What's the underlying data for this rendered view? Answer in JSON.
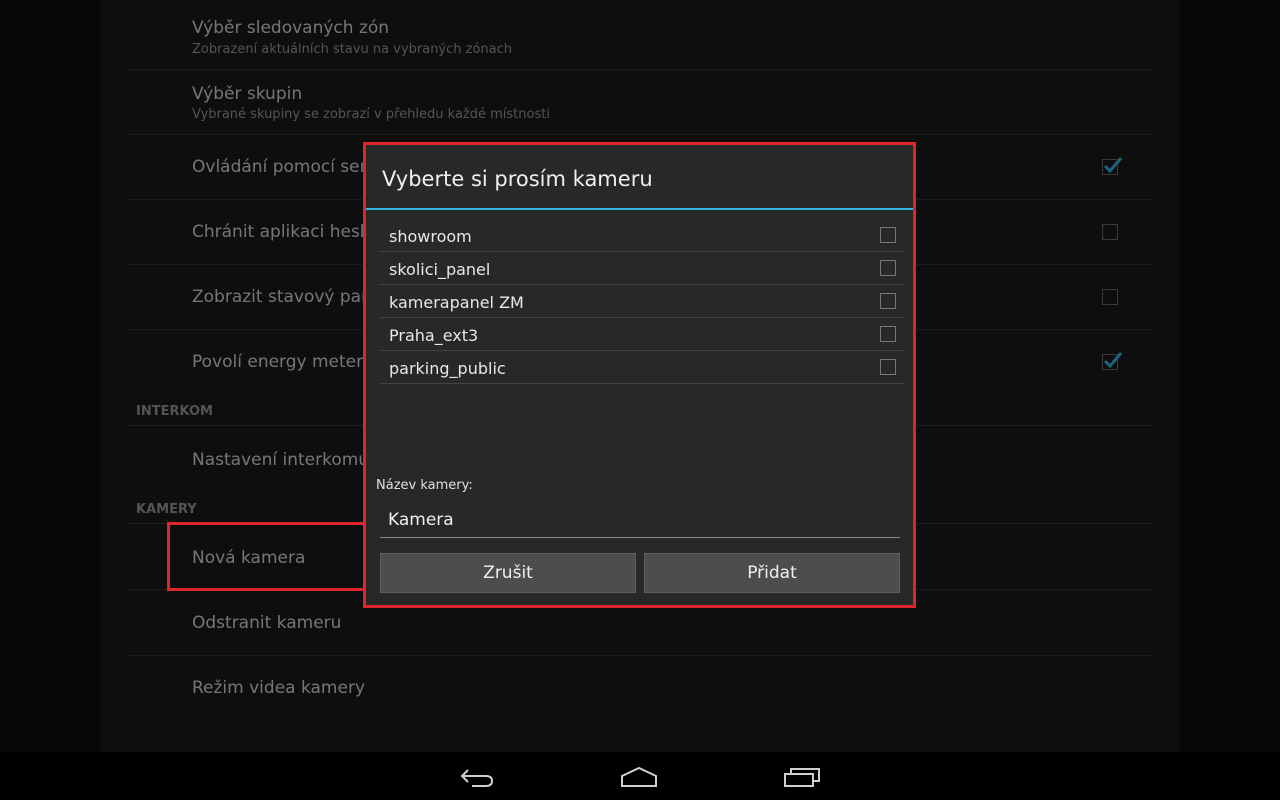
{
  "settings": {
    "rows": [
      {
        "title": "Výběr sledovaných zón",
        "sub": "Zobrazení aktuálních stavu na vybraných zónach"
      },
      {
        "title": "Výběr skupin",
        "sub": "Vybrané skupiny se zobrazí v přehledu každé místnosti"
      },
      {
        "title": "Ovládání pomocí senz",
        "checked": true
      },
      {
        "title": "Chránit aplikaci hesl",
        "checked": false
      },
      {
        "title": "Zobrazit stavový pane",
        "checked": false
      },
      {
        "title": "Povolí energy meterin",
        "checked": true
      }
    ],
    "sections": {
      "interkom": "INTERKOM",
      "kamery": "KAMERY"
    },
    "interkom_item": "Nastavení interkomu",
    "kamery_items": [
      "Nová kamera",
      "Odstranit kameru",
      "Režim videa kamery"
    ]
  },
  "dialog": {
    "title": "Vyberte si prosím kameru",
    "cameras": [
      "showroom",
      "skolici_panel",
      "kamerapanel ZM",
      "Praha_ext3",
      "parking_public"
    ],
    "name_label": "Název kamery:",
    "name_value": "Kamera",
    "cancel_label": "Zrušit",
    "add_label": "Přidat"
  },
  "colors": {
    "accent": "#33b5e5",
    "highlight": "#e0242c"
  },
  "navbar": {
    "icons": [
      "back-icon",
      "home-icon",
      "recent-apps-icon"
    ]
  }
}
